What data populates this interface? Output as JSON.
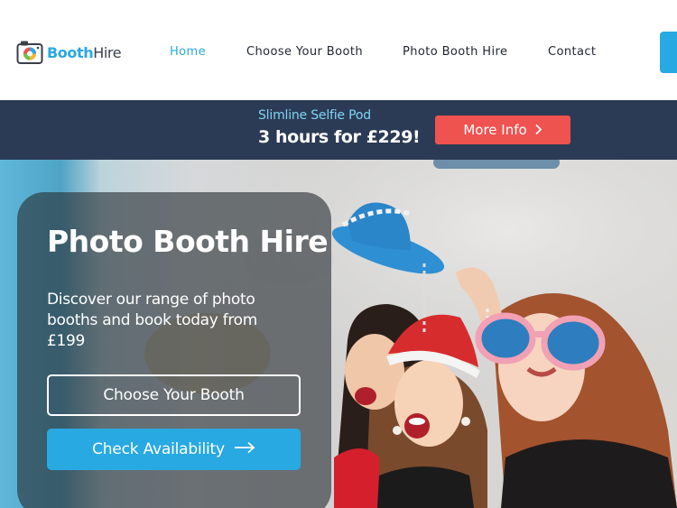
{
  "brand": {
    "name_part1": "Booth",
    "name_part2": "Hire"
  },
  "nav": {
    "items": [
      {
        "label": "Home",
        "active": true
      },
      {
        "label": "Choose Your Booth",
        "active": false
      },
      {
        "label": "Photo Booth Hire",
        "active": false
      },
      {
        "label": "Contact",
        "active": false
      }
    ]
  },
  "promo": {
    "subtitle": "Slimline Selfie Pod",
    "headline": "3 hours for £229!",
    "button_label": "More Info",
    "button_icon": "chevron-right-icon"
  },
  "hero": {
    "title": "Photo Booth Hire",
    "description": "Discover our range of photo booths and book today from £199",
    "primary_button": "Choose Your Booth",
    "secondary_button": "Check Availability",
    "secondary_icon": "arrow-right-icon"
  },
  "colors": {
    "accent": "#29a9e1",
    "promo_bg": "#2c3b55",
    "promo_button": "#ef5350",
    "text_dark": "#1f2530"
  }
}
